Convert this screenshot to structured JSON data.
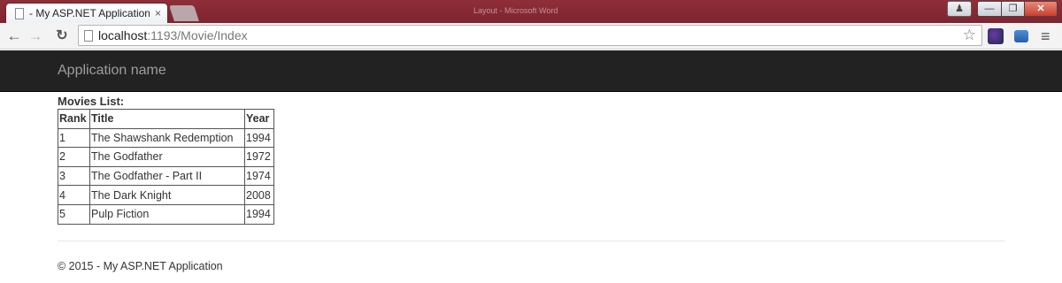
{
  "browser": {
    "tab_title": "- My ASP.NET Application",
    "tab_close": "×",
    "window_title": "Layout - Microsoft Word",
    "url_host": "localhost",
    "url_rest": ":1193/Movie/Index"
  },
  "navbar": {
    "brand": "Application name"
  },
  "main": {
    "list_title": "Movies List:",
    "columns": [
      "Rank",
      "Title",
      "Year"
    ],
    "rows": [
      [
        "1",
        "The Shawshank Redemption",
        "1994"
      ],
      [
        "2",
        "The Godfather",
        "1972"
      ],
      [
        "3",
        "The Godfather - Part II",
        "1974"
      ],
      [
        "4",
        "The Dark Knight",
        "2008"
      ],
      [
        "5",
        "Pulp Fiction",
        "1994"
      ]
    ]
  },
  "footer": {
    "text": "© 2015 - My ASP.NET Application"
  }
}
